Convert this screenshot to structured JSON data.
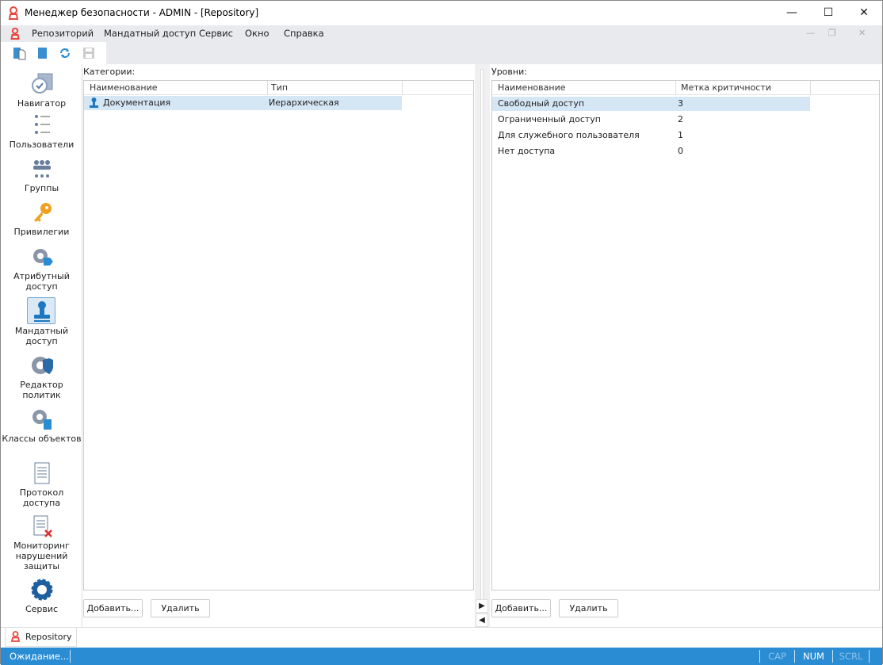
{
  "window": {
    "title": "Менеджер безопасности - ADMIN - [Repository]",
    "minimize": "—",
    "maximize": "☐",
    "close": "✕"
  },
  "menu": [
    "Репозиторий",
    "Мандатный доступ",
    "Сервис",
    "Окно",
    "Справка"
  ],
  "sidebar": [
    {
      "label": "Навигатор"
    },
    {
      "label": "Пользователи"
    },
    {
      "label": "Группы"
    },
    {
      "label": "Привилегии"
    },
    {
      "label": "Атрибутный доступ"
    },
    {
      "label": "Мандатный доступ",
      "selected": true
    },
    {
      "label": "Редактор политик"
    },
    {
      "label": "Классы объектов"
    },
    {
      "label": "Протокол доступа"
    },
    {
      "label": "Мониторинг нарушений защиты"
    },
    {
      "label": "Сервис"
    }
  ],
  "categories": {
    "label": "Категории:",
    "columns": [
      "Наименование",
      "Тип"
    ],
    "rows": [
      {
        "name": "Документация",
        "type": "Иерархическая"
      }
    ],
    "add": "Добавить...",
    "delete": "Удалить"
  },
  "levels": {
    "label": "Уровни:",
    "columns": [
      "Наименование",
      "Метка критичности"
    ],
    "rows": [
      {
        "name": "Свободный доступ",
        "mark": "3"
      },
      {
        "name": "Ограниченный доступ",
        "mark": "2"
      },
      {
        "name": "Для служебного пользователя",
        "mark": "1"
      },
      {
        "name": "Нет доступа",
        "mark": "0"
      }
    ],
    "add": "Добавить...",
    "delete": "Удалить"
  },
  "tab": "Repository",
  "status": {
    "text": "Ожидание...",
    "cap": "CAP",
    "num": "NUM",
    "scrl": "SCRL"
  },
  "colors": {
    "accent": "#2a8dd4",
    "selection": "#d5e6f5",
    "logo": "#e8473e"
  }
}
